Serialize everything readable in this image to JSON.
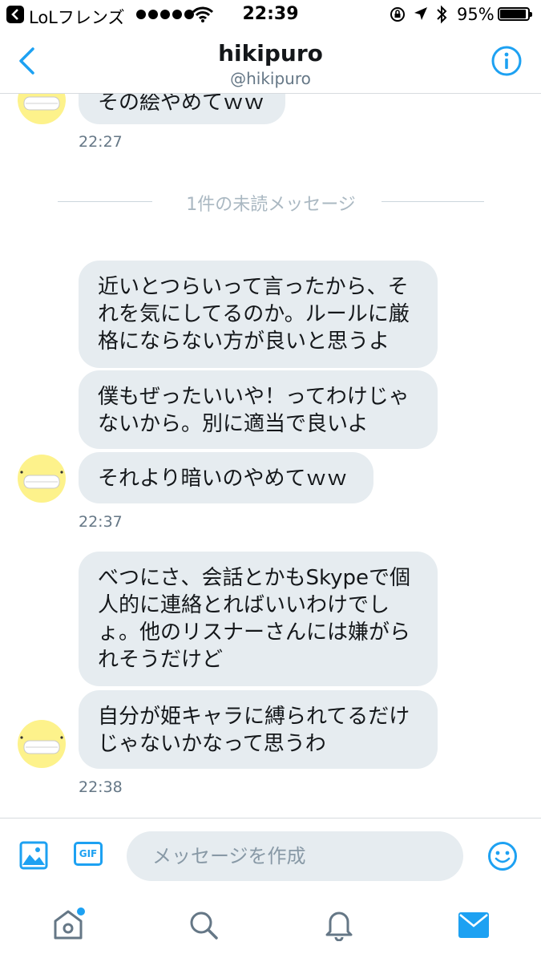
{
  "status_bar": {
    "carrier": "LoLフレンズ",
    "time": "22:39",
    "battery": "95%"
  },
  "header": {
    "name": "hikipuro",
    "handle": "@hikipuro"
  },
  "conversation": {
    "partial_message": "その絵やめてｗｗ",
    "timestamp_1": "22:27",
    "unread_divider": "1件の未読メッセージ",
    "group_2": {
      "messages": [
        "近いとつらいって言ったから、そ\nれを気にしてるのか。ルールに厳\n格にならない方が良いと思うよ",
        "僕もぜったいいや！ってわけじゃ\nないから。別に適当で良いよ",
        "それより暗いのやめてｗｗ"
      ],
      "timestamp": "22:37"
    },
    "group_3": {
      "messages": [
        "べつにさ、会話とかもSkypeで個\n人的に連絡とればいいわけでし\nょ。他のリスナーさんには嫌がら\nれそうだけど",
        "自分が姫キャラに縛られてるだけ\nじゃないかなって思うわ"
      ],
      "timestamp": "22:38"
    }
  },
  "composer": {
    "gif_label": "GIF",
    "placeholder": "メッセージを作成"
  },
  "tabs": [
    {
      "icon": "home-icon",
      "active": false,
      "notification_dot": true
    },
    {
      "icon": "search-icon",
      "active": false
    },
    {
      "icon": "bell-icon",
      "active": false
    },
    {
      "icon": "envelope-icon",
      "active": true
    }
  ],
  "colors": {
    "accent": "#1da1f2",
    "bubble": "#e6ecf0",
    "muted_text": "#657786",
    "avatar_face": "#fdf28b"
  }
}
